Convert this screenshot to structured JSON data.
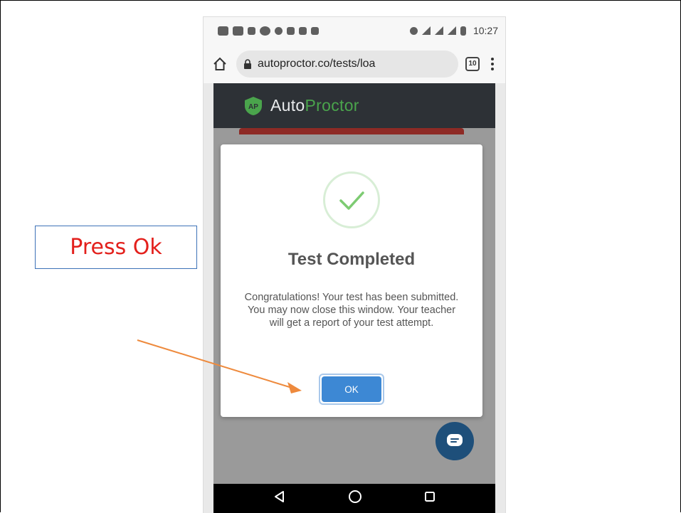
{
  "statusbar": {
    "time": "10:27"
  },
  "browser": {
    "url": "autoproctor.co/tests/loa",
    "tab_count": "10"
  },
  "app": {
    "brand_part1": "Auto",
    "brand_part2": "Proctor"
  },
  "modal": {
    "title": "Test Completed",
    "message": "Congratulations! Your test has been submitted. You may now close this window. Your teacher will get a report of your test attempt.",
    "ok_label": "OK"
  },
  "annotation": {
    "callout_text": "Press Ok"
  },
  "colors": {
    "header_bg": "#2d3136",
    "brand_green": "#4aa44c",
    "ok_blue": "#3d88d4",
    "callout_red": "#e3201c",
    "arrow_orange": "#ee8a3d"
  }
}
